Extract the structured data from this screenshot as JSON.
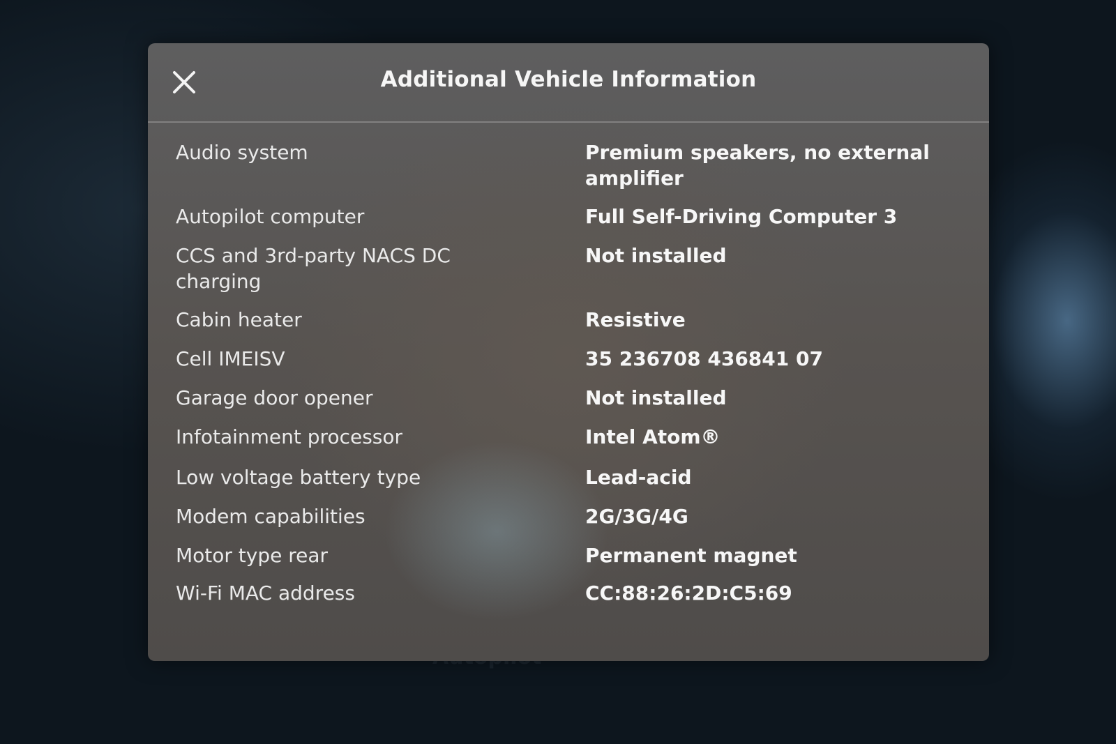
{
  "background": {
    "ghost_texts": [
      "Autopilot"
    ]
  },
  "modal": {
    "title": "Additional Vehicle Information",
    "close_icon": "close-icon",
    "rows": [
      {
        "label": "Audio system",
        "value": "Premium speakers, no external amplifier"
      },
      {
        "label": "Autopilot computer",
        "value": "Full Self-Driving Computer 3"
      },
      {
        "label": "CCS and 3rd-party NACS DC charging",
        "value": "Not installed"
      },
      {
        "label": "Cabin heater",
        "value": "Resistive"
      },
      {
        "label": "Cell IMEISV",
        "value": "35 236708 436841 07"
      },
      {
        "label": "Garage door opener",
        "value": "Not installed"
      },
      {
        "label": "Infotainment processor",
        "value": "Intel Atom®"
      },
      {
        "label": "Low voltage battery type",
        "value": "Lead-acid"
      },
      {
        "label": "Modem capabilities",
        "value": "2G/3G/4G"
      },
      {
        "label": "Motor type rear",
        "value": "Permanent magnet"
      },
      {
        "label": "Wi-Fi MAC address",
        "value": "CC:88:26:2D:C5:69"
      }
    ]
  },
  "colors": {
    "panel": "#5a5856",
    "text": "#f2f2f2",
    "background": "#0d161e"
  }
}
